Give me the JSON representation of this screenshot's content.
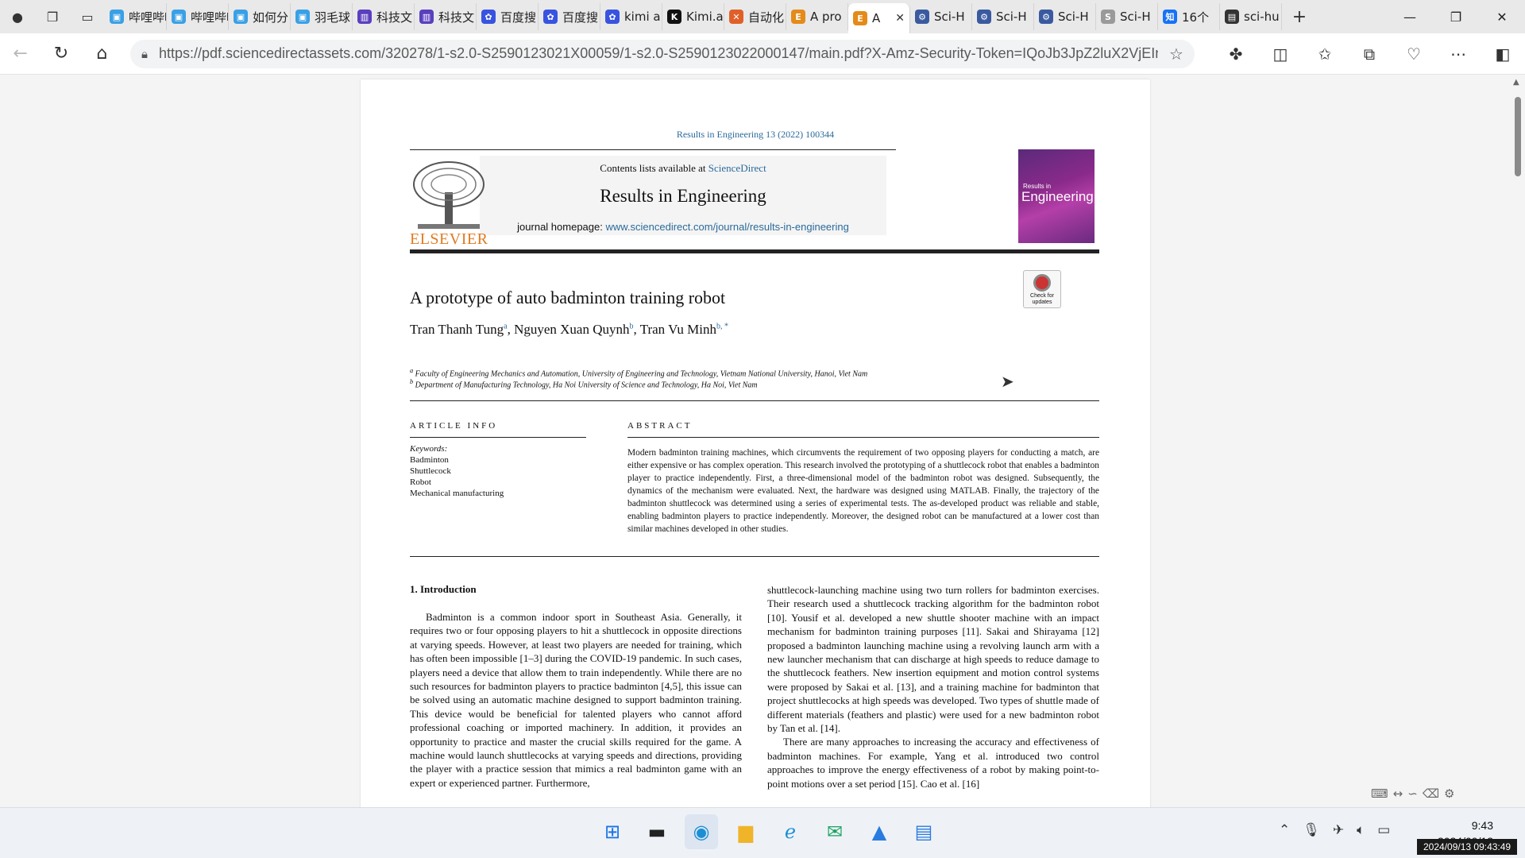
{
  "browser": {
    "tabs": [
      {
        "title": "哔哩哔哩",
        "icon": "bilibili-icon",
        "color": "#3aa0e6",
        "glyph": "▣"
      },
      {
        "title": "哔哩哔哩",
        "icon": "bilibili-icon",
        "color": "#3aa0e6",
        "glyph": "▣"
      },
      {
        "title": "如何分",
        "icon": "bilibili-icon",
        "color": "#3aa0e6",
        "glyph": "▣"
      },
      {
        "title": "羽毛球",
        "icon": "bilibili-icon",
        "color": "#3aa0e6",
        "glyph": "▣"
      },
      {
        "title": "科技文",
        "icon": "paper-icon",
        "color": "#5a3fbf",
        "glyph": "▥"
      },
      {
        "title": "科技文",
        "icon": "paper-icon",
        "color": "#5a3fbf",
        "glyph": "▥"
      },
      {
        "title": "百度搜",
        "icon": "baidu-paw-icon",
        "color": "#3853e0",
        "glyph": "✿"
      },
      {
        "title": "百度搜",
        "icon": "baidu-paw-icon",
        "color": "#3853e0",
        "glyph": "✿"
      },
      {
        "title": "kimi ai",
        "icon": "baidu-paw-icon",
        "color": "#3853e0",
        "glyph": "✿"
      },
      {
        "title": "Kimi.ai",
        "icon": "kimi-icon",
        "color": "#111111",
        "glyph": "K"
      },
      {
        "title": "自动化",
        "icon": "x-logo-icon",
        "color": "#e0602a",
        "glyph": "✕"
      },
      {
        "title": "A pro",
        "icon": "elsevier-e-icon",
        "color": "#e48b1a",
        "glyph": "E"
      },
      {
        "title": "A",
        "icon": "elsevier-e-icon",
        "color": "#e48b1a",
        "glyph": "E",
        "active": true
      },
      {
        "title": "Sci-H",
        "icon": "gear-icon",
        "color": "#3a5aa0",
        "glyph": "⚙"
      },
      {
        "title": "Sci-H",
        "icon": "gear-icon",
        "color": "#3a5aa0",
        "glyph": "⚙"
      },
      {
        "title": "Sci-H",
        "icon": "gear-icon",
        "color": "#3a5aa0",
        "glyph": "⚙"
      },
      {
        "title": "Sci-H",
        "icon": "scihub-icon",
        "color": "#9a9a9a",
        "glyph": "S"
      },
      {
        "title": "16个",
        "icon": "zhihu-icon",
        "color": "#1772f6",
        "glyph": "知"
      },
      {
        "title": "sci-hu",
        "icon": "document-icon",
        "color": "#333333",
        "glyph": "▤"
      }
    ],
    "url": "https://pdf.sciencedirectassets.com/320278/1-s2.0-S2590123021X00059/1-s2.0-S2590123022000147/main.pdf?X-Amz-Security-Token=IQoJb3JpZ2luX2VjEIn..."
  },
  "pdf": {
    "citation": "Results in Engineering 13 (2022) 100344",
    "contents_prefix": "Contents lists available at ",
    "contents_link": "ScienceDirect",
    "journal": "Results in Engineering",
    "homepage_prefix": "journal homepage: ",
    "homepage_link": "www.sciencedirect.com/journal/results-in-engineering",
    "publisher": "ELSEVIER",
    "cover_small": "Results in",
    "cover_big": "Engineering",
    "check_updates": "Check for updates",
    "title": "A prototype of auto badminton training robot",
    "authors": [
      {
        "name": "Tran Thanh Tung",
        "sup": "a"
      },
      {
        "name": "Nguyen Xuan Quynh",
        "sup": "b"
      },
      {
        "name": "Tran Vu Minh",
        "sup": "b, *"
      }
    ],
    "affiliations": [
      {
        "sup": "a",
        "text": "Faculty of Engineering Mechanics and Automation, University of Engineering and Technology, Vietnam National University, Hanoi, Viet Nam"
      },
      {
        "sup": "b",
        "text": "Department of Manufacturing Technology, Ha Noi University of Science and Technology, Ha Noi, Viet Nam"
      }
    ],
    "article_info_head": "ARTICLE INFO",
    "abstract_head": "ABSTRACT",
    "keywords_label": "Keywords:",
    "keywords": [
      "Badminton",
      "Shuttlecock",
      "Robot",
      "Mechanical manufacturing"
    ],
    "abstract": "Modern badminton training machines, which circumvents the requirement of two opposing players for conducting a match, are either expensive or has complex operation. This research involved the prototyping of a shuttlecock robot that enables a badminton player to practice independently. First, a three-dimensional model of the badminton robot was designed. Subsequently, the dynamics of the mechanism were evaluated. Next, the hardware was designed using MATLAB. Finally, the trajectory of the badminton shuttlecock was determined using a series of experimental tests. The as-developed product was reliable and stable, enabling badminton players to practice independently. Moreover, the designed robot can be manufactured at a lower cost than similar machines developed in other studies.",
    "intro_heading": "1.  Introduction",
    "col1": "Badminton is a common indoor sport in Southeast Asia. Generally, it requires two or four opposing players to hit a shuttlecock in opposite directions at varying speeds. However, at least two players are needed for training, which has often been impossible [1–3] during the COVID-19 pandemic. In such cases, players need a device that allow them to train independently. While there are no such resources for badminton players to practice badminton [4,5], this issue can be solved using an automatic machine designed to support badminton training. This device would be beneficial for talented players who cannot afford professional coaching or imported machinery. In addition, it provides an opportunity to practice and master the crucial skills required for the game. A machine would launch shuttlecocks at varying speeds and directions, providing the player with a practice session that mimics a real badminton game with an expert or experienced partner. Furthermore,",
    "col2a": "shuttlecock-launching machine using two turn rollers for badminton exercises. Their research used a shuttlecock tracking algorithm for the badminton robot [10]. Yousif et al. developed a new shuttle shooter machine with an impact mechanism for badminton training purposes [11]. Sakai and Shirayama [12] proposed a badminton launching machine using a revolving launch arm with a new launcher mechanism that can discharge at high speeds to reduce damage to the shuttlecock feathers. New insertion equipment and motion control systems were proposed by Sakai et al. [13], and a training machine for badminton that project shuttlecocks at high speeds was developed. Two types of shuttle made of different materials (feathers and plastic) were used for a new badminton robot by Tan et al. [14].",
    "col2b": "There are many approaches to increasing the accuracy and effectiveness of badminton machines. For example, Yang et al. introduced two control approaches to improve the energy effectiveness of a robot by making point-to-point motions over a set period [15]. Cao et al. [16]"
  },
  "taskbar": {
    "apps": [
      {
        "name": "start-icon",
        "glyph": "⊞",
        "color": "#1a73e8"
      },
      {
        "name": "task-view-icon",
        "glyph": "▬",
        "color": "#222"
      },
      {
        "name": "edge-icon",
        "glyph": "◉",
        "color": "#1b8fd6",
        "active": true
      },
      {
        "name": "file-explorer-icon",
        "glyph": "▆",
        "color": "#f0b429"
      },
      {
        "name": "edge-legacy-icon",
        "glyph": "ℯ",
        "color": "#1b8fd6"
      },
      {
        "name": "mail-icon",
        "glyph": "✉",
        "color": "#1aa360"
      },
      {
        "name": "photos-icon",
        "glyph": "▲",
        "color": "#2a7be0"
      },
      {
        "name": "notepad-icon",
        "glyph": "▤",
        "color": "#2a7be0"
      }
    ],
    "time": "9:43",
    "date": "2024/09/13",
    "stamp": "2024/09/13 09:43:49"
  }
}
